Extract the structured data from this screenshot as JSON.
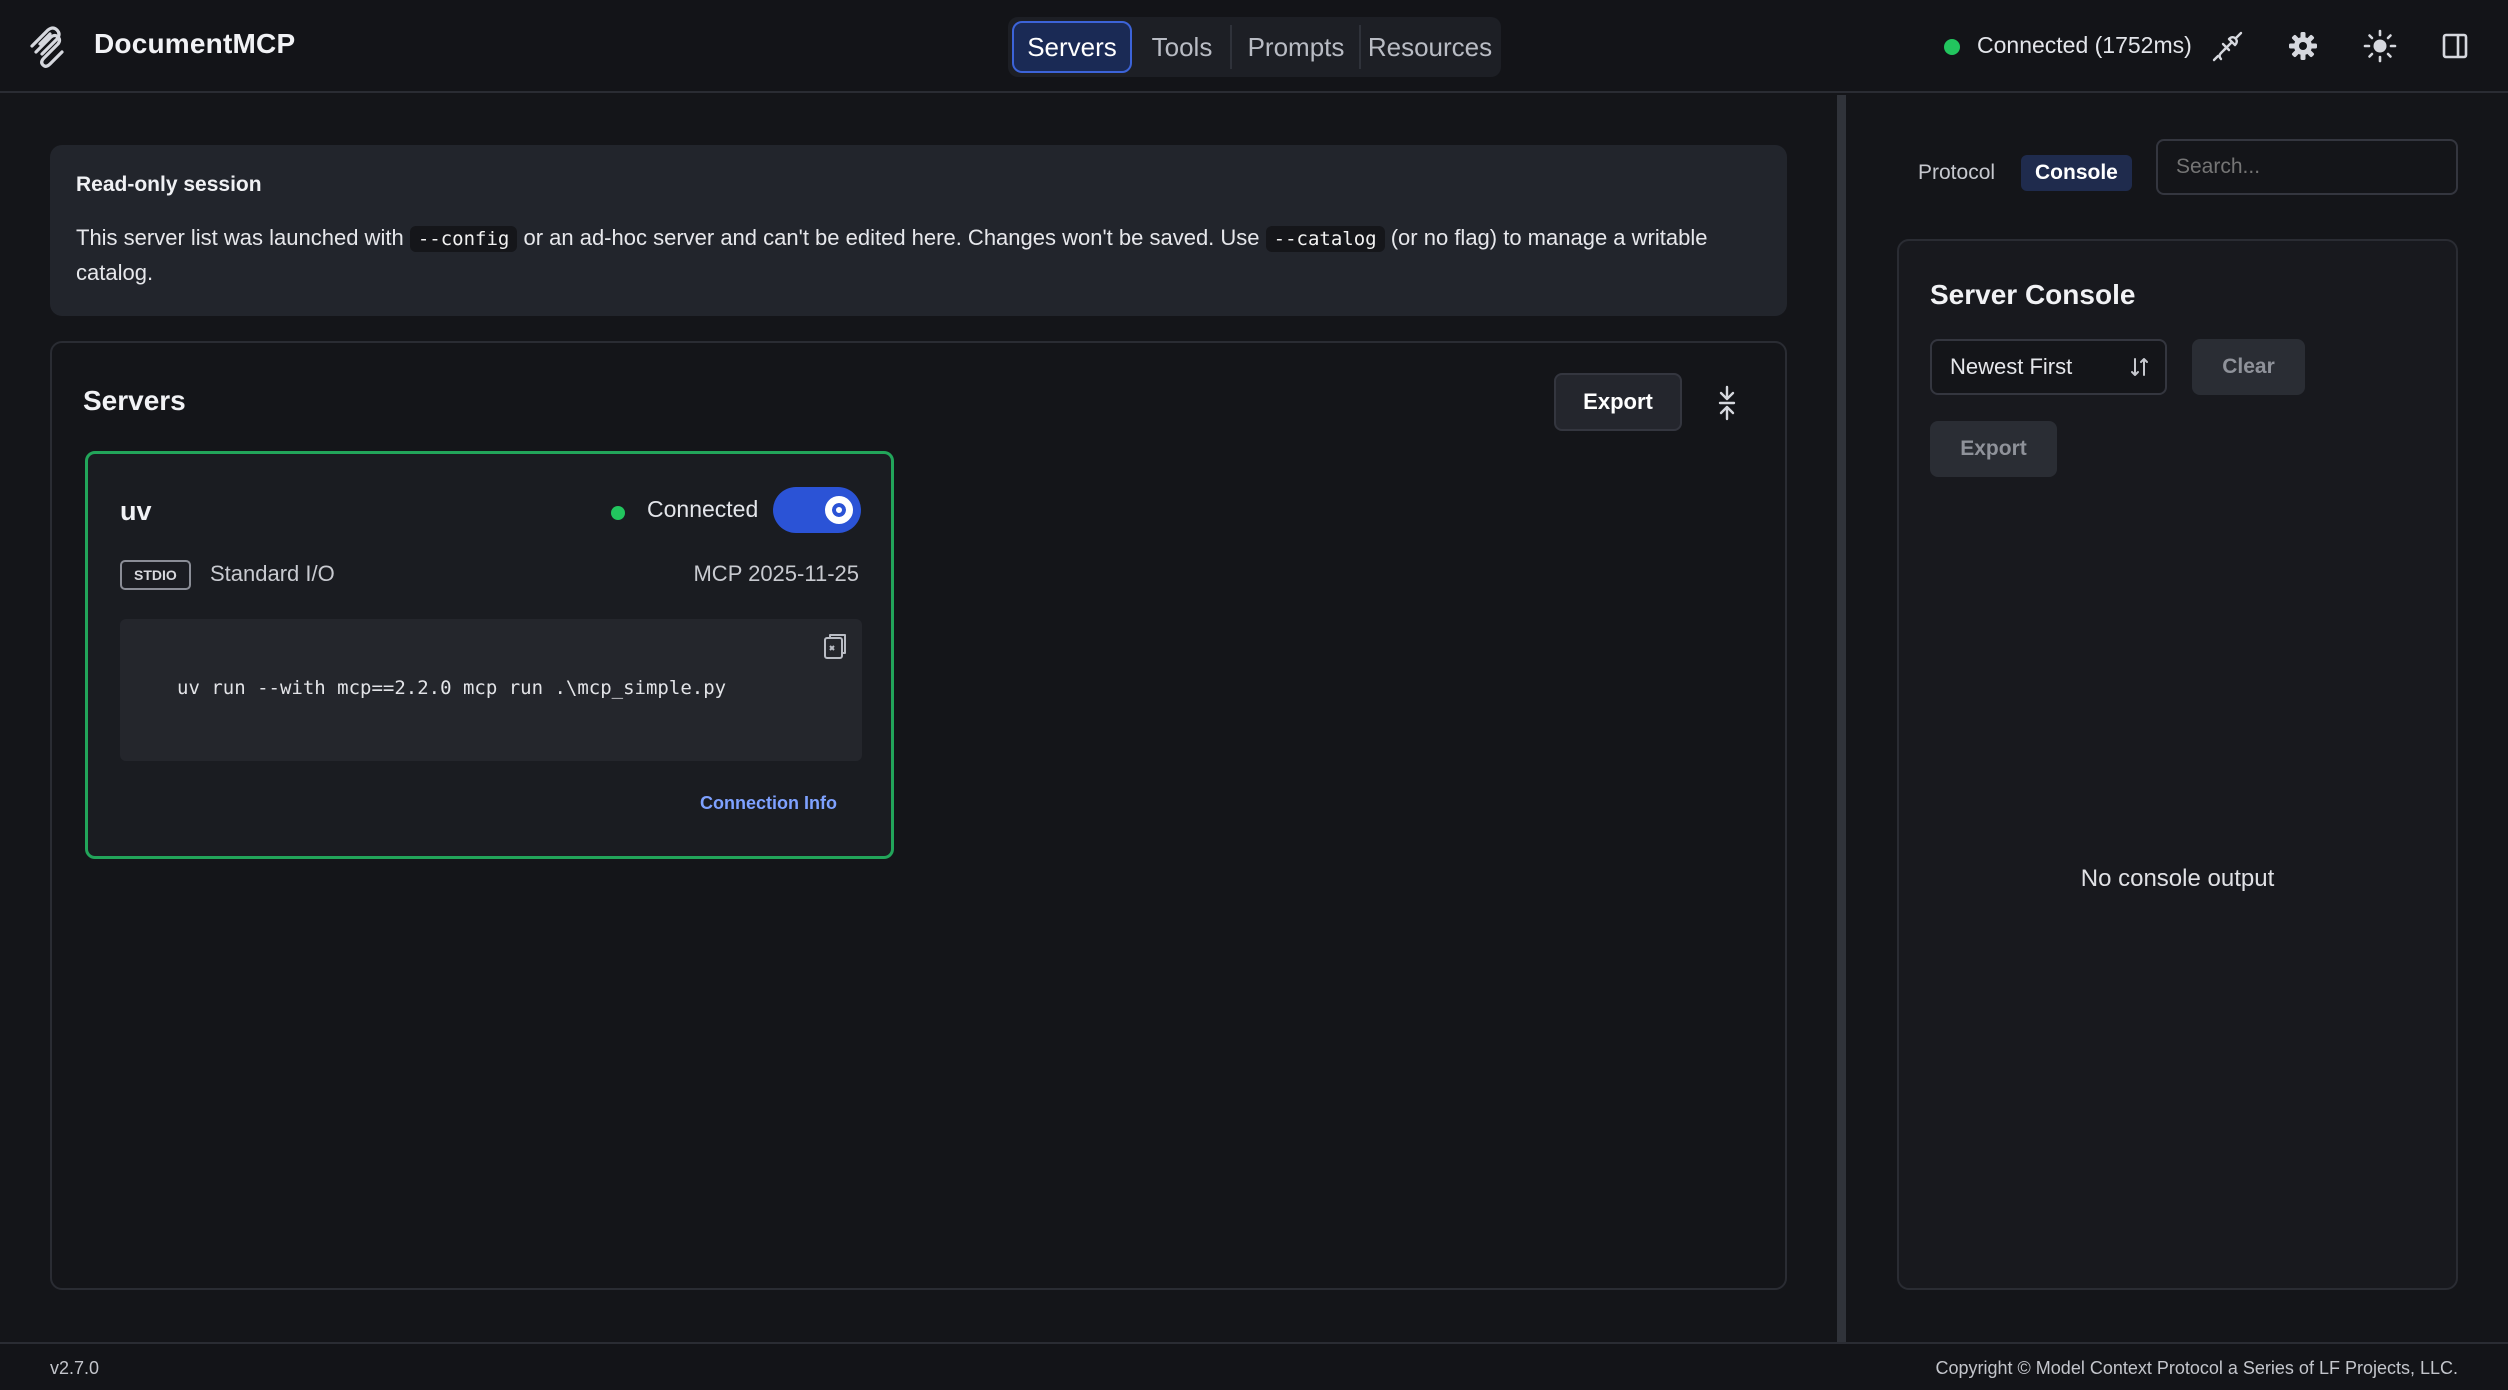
{
  "header": {
    "brand": "DocumentMCP",
    "tabs": [
      {
        "label": "Servers",
        "active": true
      },
      {
        "label": "Tools",
        "active": false
      },
      {
        "label": "Prompts",
        "active": false
      },
      {
        "label": "Resources",
        "active": false
      }
    ],
    "connection_status": "Connected (1752ms)",
    "icons": [
      "plug-icon",
      "gear-icon",
      "sun-icon",
      "panel-toggle-icon"
    ]
  },
  "notice": {
    "title": "Read-only session",
    "text_1": "This server list was launched with",
    "code_1": "--config",
    "text_2": "or an ad-hoc server and can't be edited here. Changes won't be saved. Use",
    "code_2": "--catalog",
    "text_3": "(or no flag) to manage a writable catalog."
  },
  "servers": {
    "title": "Servers",
    "export_label": "Export",
    "items": [
      {
        "name": "uv",
        "status": "Connected",
        "enabled": true,
        "transport_badge": "STDIO",
        "transport": "Standard I/O",
        "protocol_version": "MCP 2025-11-25",
        "command": "uv run --with mcp==2.2.0 mcp run .\\mcp_simple.py",
        "connection_info_label": "Connection Info"
      }
    ]
  },
  "right_panel": {
    "tabs": [
      {
        "label": "Protocol",
        "active": false
      },
      {
        "label": "Console",
        "active": true
      }
    ],
    "search_placeholder": "Search...",
    "console": {
      "title": "Server Console",
      "sort_value": "Newest First",
      "clear_label": "Clear",
      "export_label": "Export",
      "empty_message": "No console output"
    }
  },
  "footer": {
    "version": "v2.7.0",
    "copyright": "Copyright © Model Context Protocol a Series of LF Projects, LLC."
  },
  "colors": {
    "accent": "#3c63d8",
    "connected": "#22c55e",
    "link": "#7ea1ff"
  }
}
